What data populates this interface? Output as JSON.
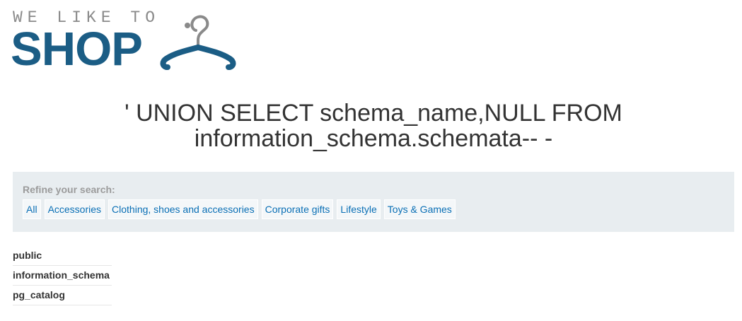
{
  "logo": {
    "tagline": "WE LIKE TO",
    "wordmark": "SHOP",
    "icon": "hanger-icon",
    "colors": {
      "tagline": "#8a8a8a",
      "wordmark": "#1b5d85",
      "hook": "#8a8a8a"
    }
  },
  "heading": {
    "line1": "' UNION SELECT schema_name,NULL FROM",
    "line2": "information_schema.schemata-- -"
  },
  "filter": {
    "label": "Refine your search:",
    "categories": [
      "All",
      "Accessories",
      "Clothing, shoes and accessories",
      "Corporate gifts",
      "Lifestyle",
      "Toys & Games"
    ],
    "colors": {
      "panel": "#e8edf0",
      "link": "#0a6fb5"
    }
  },
  "results": [
    "public",
    "information_schema",
    "pg_catalog"
  ]
}
